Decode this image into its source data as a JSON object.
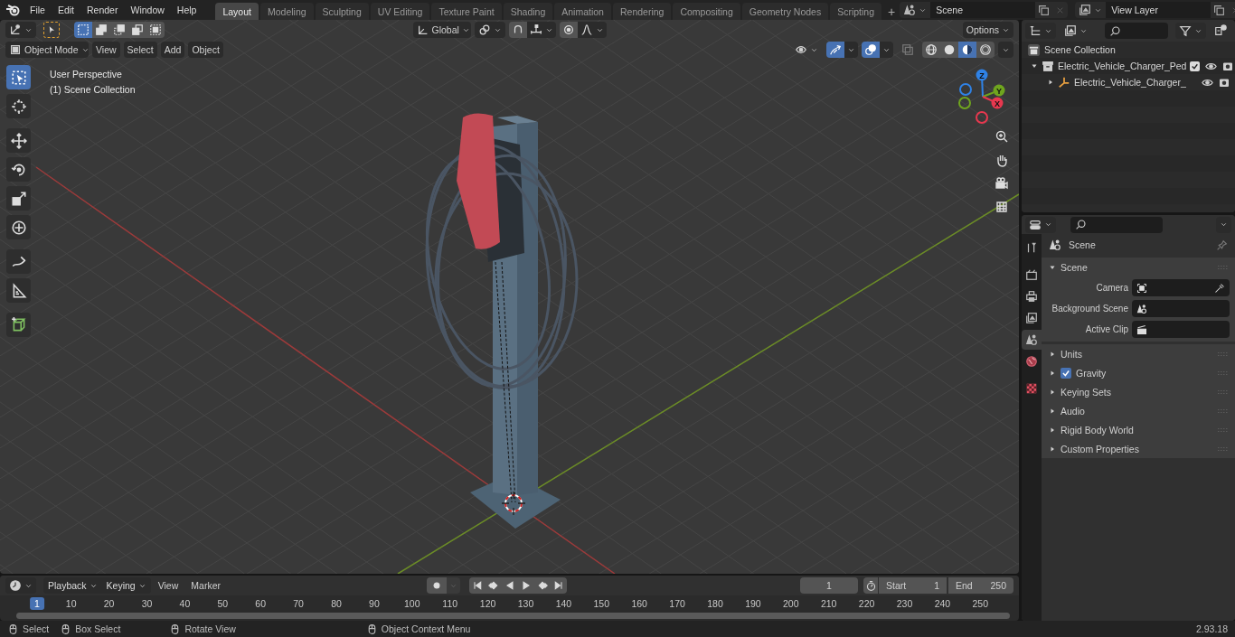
{
  "menubar": {
    "menus": [
      "File",
      "Edit",
      "Render",
      "Window",
      "Help"
    ]
  },
  "workspace_tabs": [
    {
      "label": "Layout",
      "selected": true
    },
    {
      "label": "Modeling",
      "selected": false
    },
    {
      "label": "Sculpting",
      "selected": false
    },
    {
      "label": "UV Editing",
      "selected": false
    },
    {
      "label": "Texture Paint",
      "selected": false
    },
    {
      "label": "Shading",
      "selected": false
    },
    {
      "label": "Animation",
      "selected": false
    },
    {
      "label": "Rendering",
      "selected": false
    },
    {
      "label": "Compositing",
      "selected": false
    },
    {
      "label": "Geometry Nodes",
      "selected": false
    },
    {
      "label": "Scripting",
      "selected": false
    }
  ],
  "add_tab": "+",
  "scene_selector": {
    "value": "Scene"
  },
  "view_layer_selector": {
    "value": "View Layer"
  },
  "viewport": {
    "select_modes": [
      {
        "selected": true
      },
      {
        "selected": false
      },
      {
        "selected": false
      },
      {
        "selected": false
      },
      {
        "selected": false
      }
    ],
    "transform_orientation": "Global",
    "options_label": "Options",
    "mode": "Object Mode",
    "menus": [
      "View",
      "Select",
      "Add",
      "Object"
    ],
    "gizmos_on": true,
    "overlays_on": true,
    "xray_on": false,
    "shading_modes": [
      {
        "selected": false
      },
      {
        "selected": false
      },
      {
        "selected": true
      },
      {
        "selected": false
      }
    ],
    "perspective_label": "User Perspective",
    "collection_label": "(1) Scene Collection",
    "tools": [
      {
        "selected": true
      },
      {
        "selected": false
      },
      {
        "selected": false
      },
      {
        "selected": false
      },
      {
        "selected": false
      },
      {
        "selected": false
      },
      {
        "selected": false
      },
      {
        "selected": false
      },
      {
        "selected": false
      }
    ],
    "gizmo_axes": [
      {
        "label": "Z",
        "color": "#2f82e6"
      },
      {
        "label": "Y",
        "color": "#6fa51e"
      },
      {
        "label": "X",
        "color": "#e8384f"
      }
    ]
  },
  "outliner": {
    "root": "Scene Collection",
    "items": [
      {
        "kind": "collection",
        "label": "Electric_Vehicle_Charger_Ped",
        "expanded": true,
        "checked": true,
        "visible": true,
        "children": [
          {
            "kind": "object",
            "label": "Electric_Vehicle_Charger_",
            "expanded": false,
            "visible": true
          }
        ]
      }
    ]
  },
  "properties": {
    "tabs": [
      {
        "selected": false
      },
      {
        "selected": false
      },
      {
        "selected": false
      },
      {
        "selected": false
      },
      {
        "selected": true
      },
      {
        "selected": false
      },
      {
        "selected": false
      }
    ],
    "context": "Scene",
    "panel": {
      "title": "Scene",
      "expanded": true,
      "fields": [
        {
          "label": "Camera"
        },
        {
          "label": "Background Scene"
        },
        {
          "label": "Active Clip"
        }
      ]
    },
    "subpanels": [
      {
        "kind": "plain",
        "title": "Units",
        "expanded": false
      },
      {
        "kind": "toggle",
        "title": "Gravity",
        "expanded": false,
        "checked": true
      },
      {
        "kind": "plain",
        "title": "Keying Sets",
        "expanded": false
      },
      {
        "kind": "plain",
        "title": "Audio",
        "expanded": false
      },
      {
        "kind": "plain",
        "title": "Rigid Body World",
        "expanded": false
      },
      {
        "kind": "plain",
        "title": "Custom Properties",
        "expanded": false
      }
    ]
  },
  "timeline": {
    "menus": [
      "Playback",
      "Keying",
      "View",
      "Marker"
    ],
    "current_frame": "1",
    "start_label": "Start",
    "start": "1",
    "end_label": "End",
    "end": "250",
    "frame_ticks": [
      {
        "label": "1",
        "selected": true
      },
      {
        "label": "10",
        "selected": false
      },
      {
        "label": "20",
        "selected": false
      },
      {
        "label": "30",
        "selected": false
      },
      {
        "label": "40",
        "selected": false
      },
      {
        "label": "50",
        "selected": false
      },
      {
        "label": "60",
        "selected": false
      },
      {
        "label": "70",
        "selected": false
      },
      {
        "label": "80",
        "selected": false
      },
      {
        "label": "90",
        "selected": false
      },
      {
        "label": "100",
        "selected": false
      },
      {
        "label": "110",
        "selected": false
      },
      {
        "label": "120",
        "selected": false
      },
      {
        "label": "130",
        "selected": false
      },
      {
        "label": "140",
        "selected": false
      },
      {
        "label": "150",
        "selected": false
      },
      {
        "label": "160",
        "selected": false
      },
      {
        "label": "170",
        "selected": false
      },
      {
        "label": "180",
        "selected": false
      },
      {
        "label": "190",
        "selected": false
      },
      {
        "label": "200",
        "selected": false
      },
      {
        "label": "210",
        "selected": false
      },
      {
        "label": "220",
        "selected": false
      },
      {
        "label": "230",
        "selected": false
      },
      {
        "label": "240",
        "selected": false
      },
      {
        "label": "250",
        "selected": false
      }
    ]
  },
  "status_bar": {
    "hints": [
      "Select",
      "Box Select",
      "Rotate View",
      "Object Context Menu"
    ],
    "version": "2.93.18"
  }
}
